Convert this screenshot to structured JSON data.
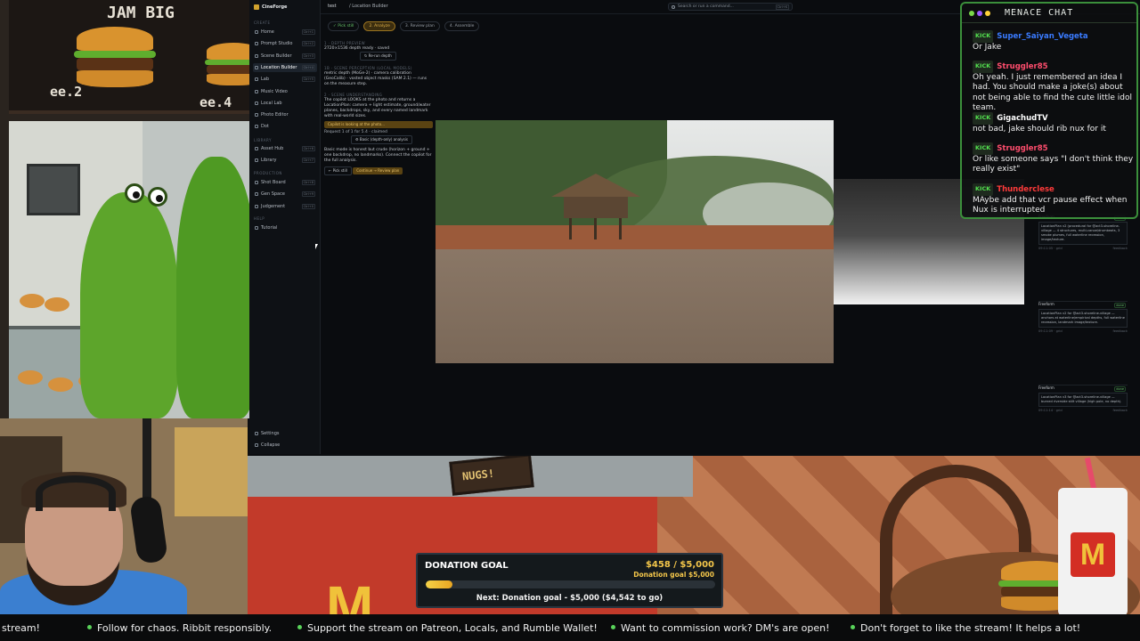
{
  "game_top": {
    "menu_title": "JAM BIG",
    "price_left": "ee.2",
    "price_right": "ee.4"
  },
  "app": {
    "brand": "CineForge",
    "sections": {
      "create": "CREATE",
      "library": "LIBRARY",
      "production": "PRODUCTION",
      "help": "HELP"
    },
    "nav_create": [
      {
        "label": "Home",
        "kbd": "Ctrl+1"
      },
      {
        "label": "Prompt Studio",
        "kbd": "Ctrl+2"
      },
      {
        "label": "Scene Builder",
        "kbd": "Ctrl+3"
      },
      {
        "label": "Location Builder",
        "kbd": "Ctrl+4"
      },
      {
        "label": "Lab",
        "kbd": "Ctrl+5"
      },
      {
        "label": "Music Video",
        "kbd": ""
      },
      {
        "label": "Local Lab",
        "kbd": ""
      },
      {
        "label": "Photo Editor",
        "kbd": ""
      },
      {
        "label": "Dot",
        "kbd": ""
      }
    ],
    "nav_library": [
      {
        "label": "Asset Hub",
        "kbd": "Ctrl+6"
      },
      {
        "label": "Library",
        "kbd": "Ctrl+7"
      }
    ],
    "nav_production": [
      {
        "label": "Shot Board",
        "kbd": "Ctrl+8"
      },
      {
        "label": "Gen Space",
        "kbd": "Ctrl+9"
      },
      {
        "label": "Judgement",
        "kbd": "Ctrl+0"
      }
    ],
    "nav_help": [
      {
        "label": "Tutorial",
        "kbd": ""
      }
    ],
    "nav_bottom": [
      {
        "label": "Settings"
      },
      {
        "label": "Collapse"
      }
    ],
    "topbar": {
      "project": "test",
      "breadcrumb": "/ Location Builder",
      "search_placeholder": "Search or run a command...",
      "search_kbd": "Ctrl+K"
    },
    "steps": [
      {
        "label": "✓ Pick still",
        "state": "done"
      },
      {
        "label": "2. Analyze",
        "state": "current"
      },
      {
        "label": "3. Review plan",
        "state": "todo"
      },
      {
        "label": "4. Assemble",
        "state": "todo"
      }
    ],
    "panel": {
      "h1": "1 · DEPTH PREVIEW",
      "p1": "2720×1536 depth ready · saved",
      "rerun": "↻ Re-run depth",
      "h2": "1B · SCENE PERCEPTION (LOCAL MODELS)",
      "p2": "metric depth (MoGe-2) · camera calibration (GeoCalib) · vosted object masks (SAM 2.1) — runs on the measure step.",
      "h3": "2 · SCENE UNDERSTANDING",
      "p3": "The copilot LOOKS at the photo and returns a LocationPlan: camera + light estimate, ground/water planes, backdrops, sky, and every named landmark with real-world sizes.",
      "copilot_btn": "Copilot is looking at the photo...",
      "request": "Request 1 of 1 for 5.4",
      "request_state": "claimed",
      "basic_btn": "⚙ Basic (depth-only) analysis",
      "p4": "Basic mode is honest but crude (horizon + ground + one backdrop, no landmarks). Connect the copilot for the full analysis.",
      "back": "← Pick still",
      "continue": "Continue → Review plan"
    },
    "log": [
      {
        "title": "Freeform",
        "status": "done",
        "text": "LocationPlan v2 (procedural for @act3-shoreline-village — 4 structures, multi-canoe/drumbeats, 3 smoke plumes, full waterline recession, image/texture.",
        "time": "09:11:05 · grid",
        "link": "feedback"
      },
      {
        "title": "Freeform",
        "status": "done",
        "text": "LocationPlan v2 for @act3-shoreline-village — anchors at waterline/empirical depths, full waterline recession, landmark image/texture.",
        "time": "09:11:09 · grid",
        "link": "feedback"
      },
      {
        "title": "Freeform",
        "status": "done",
        "text": "LocationPlan v3 for @act3-shoreline-village — burned riverside stilt village (high pole, no depth).",
        "time": "09:11:14 · grid",
        "link": "feedback"
      }
    ]
  },
  "chat": {
    "title": "MENACE CHAT",
    "badge": "KICK",
    "messages": [
      {
        "user": "Super_Saiyan_Vegeta",
        "color": "#3a7bff",
        "text": "Or Jake"
      },
      {
        "user": "Struggler85",
        "color": "#ff4d6d",
        "text": "Oh yeah. I just remembered an idea I had. You should make a joke(s) about not being able to find the cute little idol team."
      },
      {
        "user": "GigachudTV",
        "color": "#ffffff",
        "text": "not bad, jake should rib nux for it"
      },
      {
        "user": "Struggler85",
        "color": "#ff4d6d",
        "text": "Or like someone says \"I don't think they really exist\""
      },
      {
        "user": "Thunderclese",
        "color": "#ff3a3a",
        "text": "MAybe add that vcr pause effect when Nux is interrupted"
      }
    ]
  },
  "game_bottom": {
    "sign_text": "NUGS!",
    "cup_logo": "M",
    "arches": "M"
  },
  "donation": {
    "title": "DONATION GOAL",
    "amount": "$458 / $5,000",
    "sub": "Donation goal $5,000",
    "progress": 0.0916,
    "next": "Next: Donation goal - $5,000 ($4,542 to go)"
  },
  "ticker": [
    "stream!",
    "Follow for chaos. Ribbit responsibly.",
    "Support the stream on Patreon, Locals, and Rumble Wallet!",
    "Want to commission work? DM's are open!",
    "Don't forget to like the stream! It helps a lot!"
  ]
}
